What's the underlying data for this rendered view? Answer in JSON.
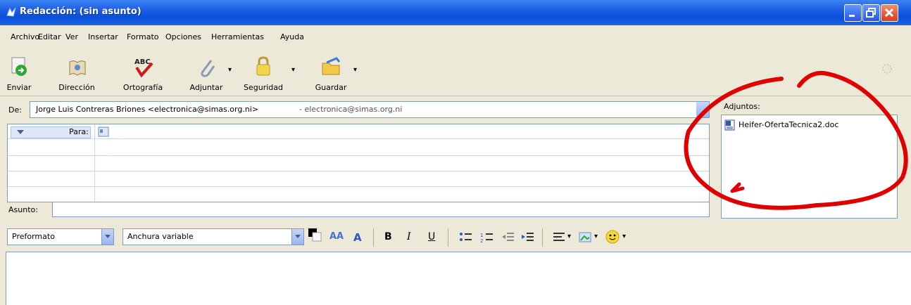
{
  "window": {
    "title": "Redacción: (sin asunto)"
  },
  "menu": [
    "Archivo",
    "Editar",
    "Ver",
    "Insertar",
    "Formato",
    "Opciones",
    "Herramientas",
    "Ayuda"
  ],
  "toolbar": {
    "send": "Enviar",
    "address": "Dirección",
    "spelling": "Ortografía",
    "spelling_icon_text": "ABC",
    "attach": "Adjuntar",
    "security": "Seguridad",
    "save": "Guardar"
  },
  "header": {
    "from_label": "De:",
    "from_value": "Jorge Luis Contreras Briones <electronica@simas.org.ni>",
    "from_account": "- electronica@simas.org.ni",
    "to_label": "Para:",
    "subject_label": "Asunto:",
    "subject_value": ""
  },
  "attachments": {
    "label": "Adjuntos:",
    "items": [
      "Heifer-OfertaTecnica2.doc"
    ]
  },
  "format": {
    "paragraph_style": "Preformato",
    "font": "Anchura variable",
    "bold": "B",
    "italic": "I",
    "underline": "U"
  },
  "colors": {
    "title_bar": "#0a4fd8",
    "annotation": "#e00000"
  }
}
